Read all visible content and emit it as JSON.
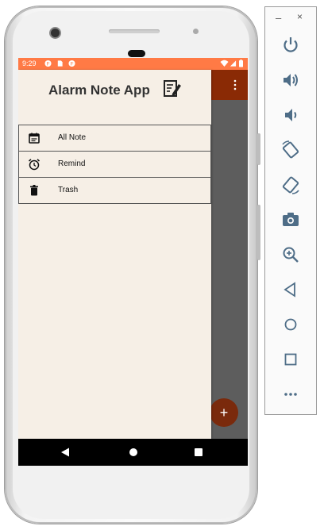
{
  "status_bar": {
    "time": "9:29",
    "left_icons": [
      "notification-icon",
      "sim-icon",
      "notification-icon"
    ],
    "right_icons": [
      "wifi-icon",
      "signal-icon",
      "battery-icon"
    ],
    "color": "#ff7a45"
  },
  "app_bar": {
    "color": "#8a2a05",
    "overflow_icon": "more-vert-icon"
  },
  "drawer": {
    "title": "Alarm Note App",
    "header_icon": "note-edit-icon",
    "background": "#f6efe6",
    "items": [
      {
        "label": "All Note",
        "icon": "calendar-note-icon"
      },
      {
        "label": "Remind",
        "icon": "alarm-clock-icon"
      },
      {
        "label": "Trash",
        "icon": "trash-icon"
      }
    ]
  },
  "fab": {
    "label": "+",
    "color": "#7a2a0c"
  },
  "nav_bar": {
    "icons": [
      "back-icon",
      "home-icon",
      "recents-icon"
    ]
  },
  "emulator_toolbar": {
    "minimize_label": "–",
    "close_label": "×",
    "buttons": [
      "power-icon",
      "volume-up-icon",
      "volume-down-icon",
      "rotate-left-icon",
      "rotate-right-icon",
      "camera-icon",
      "zoom-icon",
      "back-icon",
      "home-icon",
      "overview-icon",
      "more-icon"
    ]
  }
}
